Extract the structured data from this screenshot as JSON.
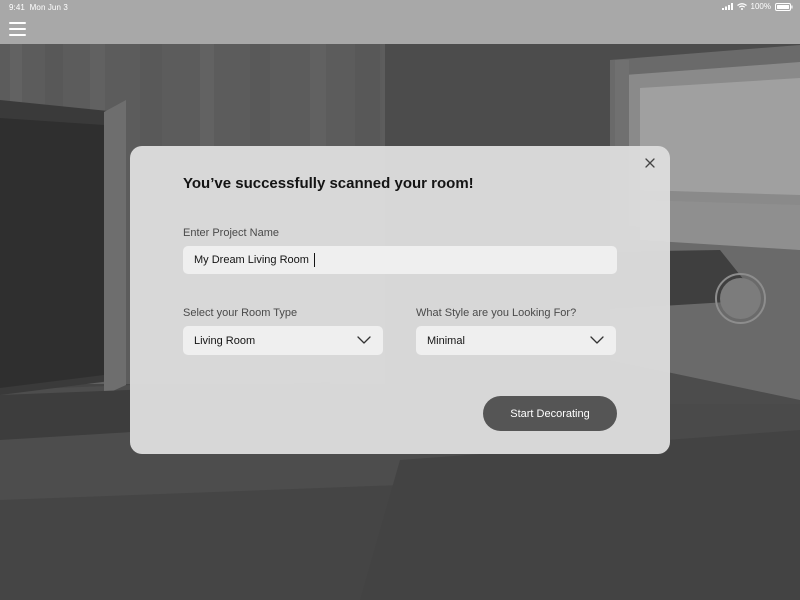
{
  "status_bar": {
    "time": "9:41",
    "date": "Mon Jun 3",
    "battery": "100%",
    "icons": [
      "signal-icon",
      "wifi-icon",
      "battery-icon"
    ]
  },
  "header": {
    "menu_icon": "hamburger-menu-icon"
  },
  "camera": {
    "shutter_icon": "shutter-button-icon"
  },
  "modal": {
    "title": "You’ve successfully scanned your room!",
    "close_icon": "close-icon",
    "project_name": {
      "label": "Enter Project Name",
      "value": "My Dream Living Room"
    },
    "room_type": {
      "label": "Select your Room Type",
      "value": "Living Room",
      "icon": "chevron-down-icon"
    },
    "style": {
      "label": "What Style are you Looking For?",
      "value": "Minimal",
      "icon": "chevron-down-icon"
    },
    "submit_label": "Start Decorating"
  },
  "colors": {
    "modal_background": "#dcdcdc",
    "input_background": "#efefef",
    "button_background": "#555555",
    "header_background": "#a7a7a7"
  }
}
